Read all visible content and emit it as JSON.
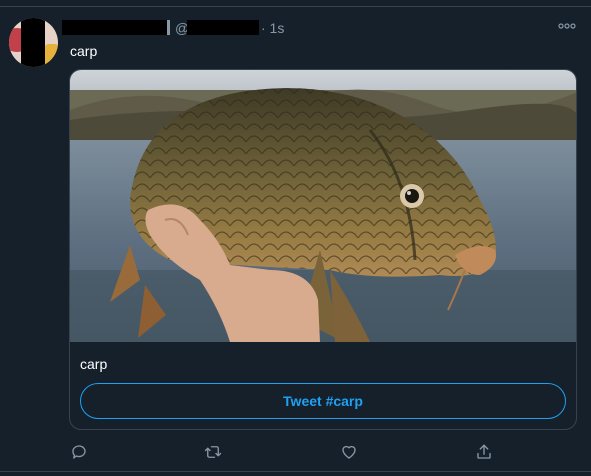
{
  "tweet": {
    "handle_prefix": "@",
    "timestamp": "· 1s",
    "text": "carp"
  },
  "card": {
    "caption": "carp",
    "button_label": "Tweet #carp"
  },
  "actions": [
    "reply-icon",
    "retweet-icon",
    "like-icon",
    "share-icon"
  ],
  "colors": {
    "background": "#15202b",
    "divider": "#38444d",
    "secondary_text": "#8899a6",
    "accent": "#1da1f2"
  }
}
